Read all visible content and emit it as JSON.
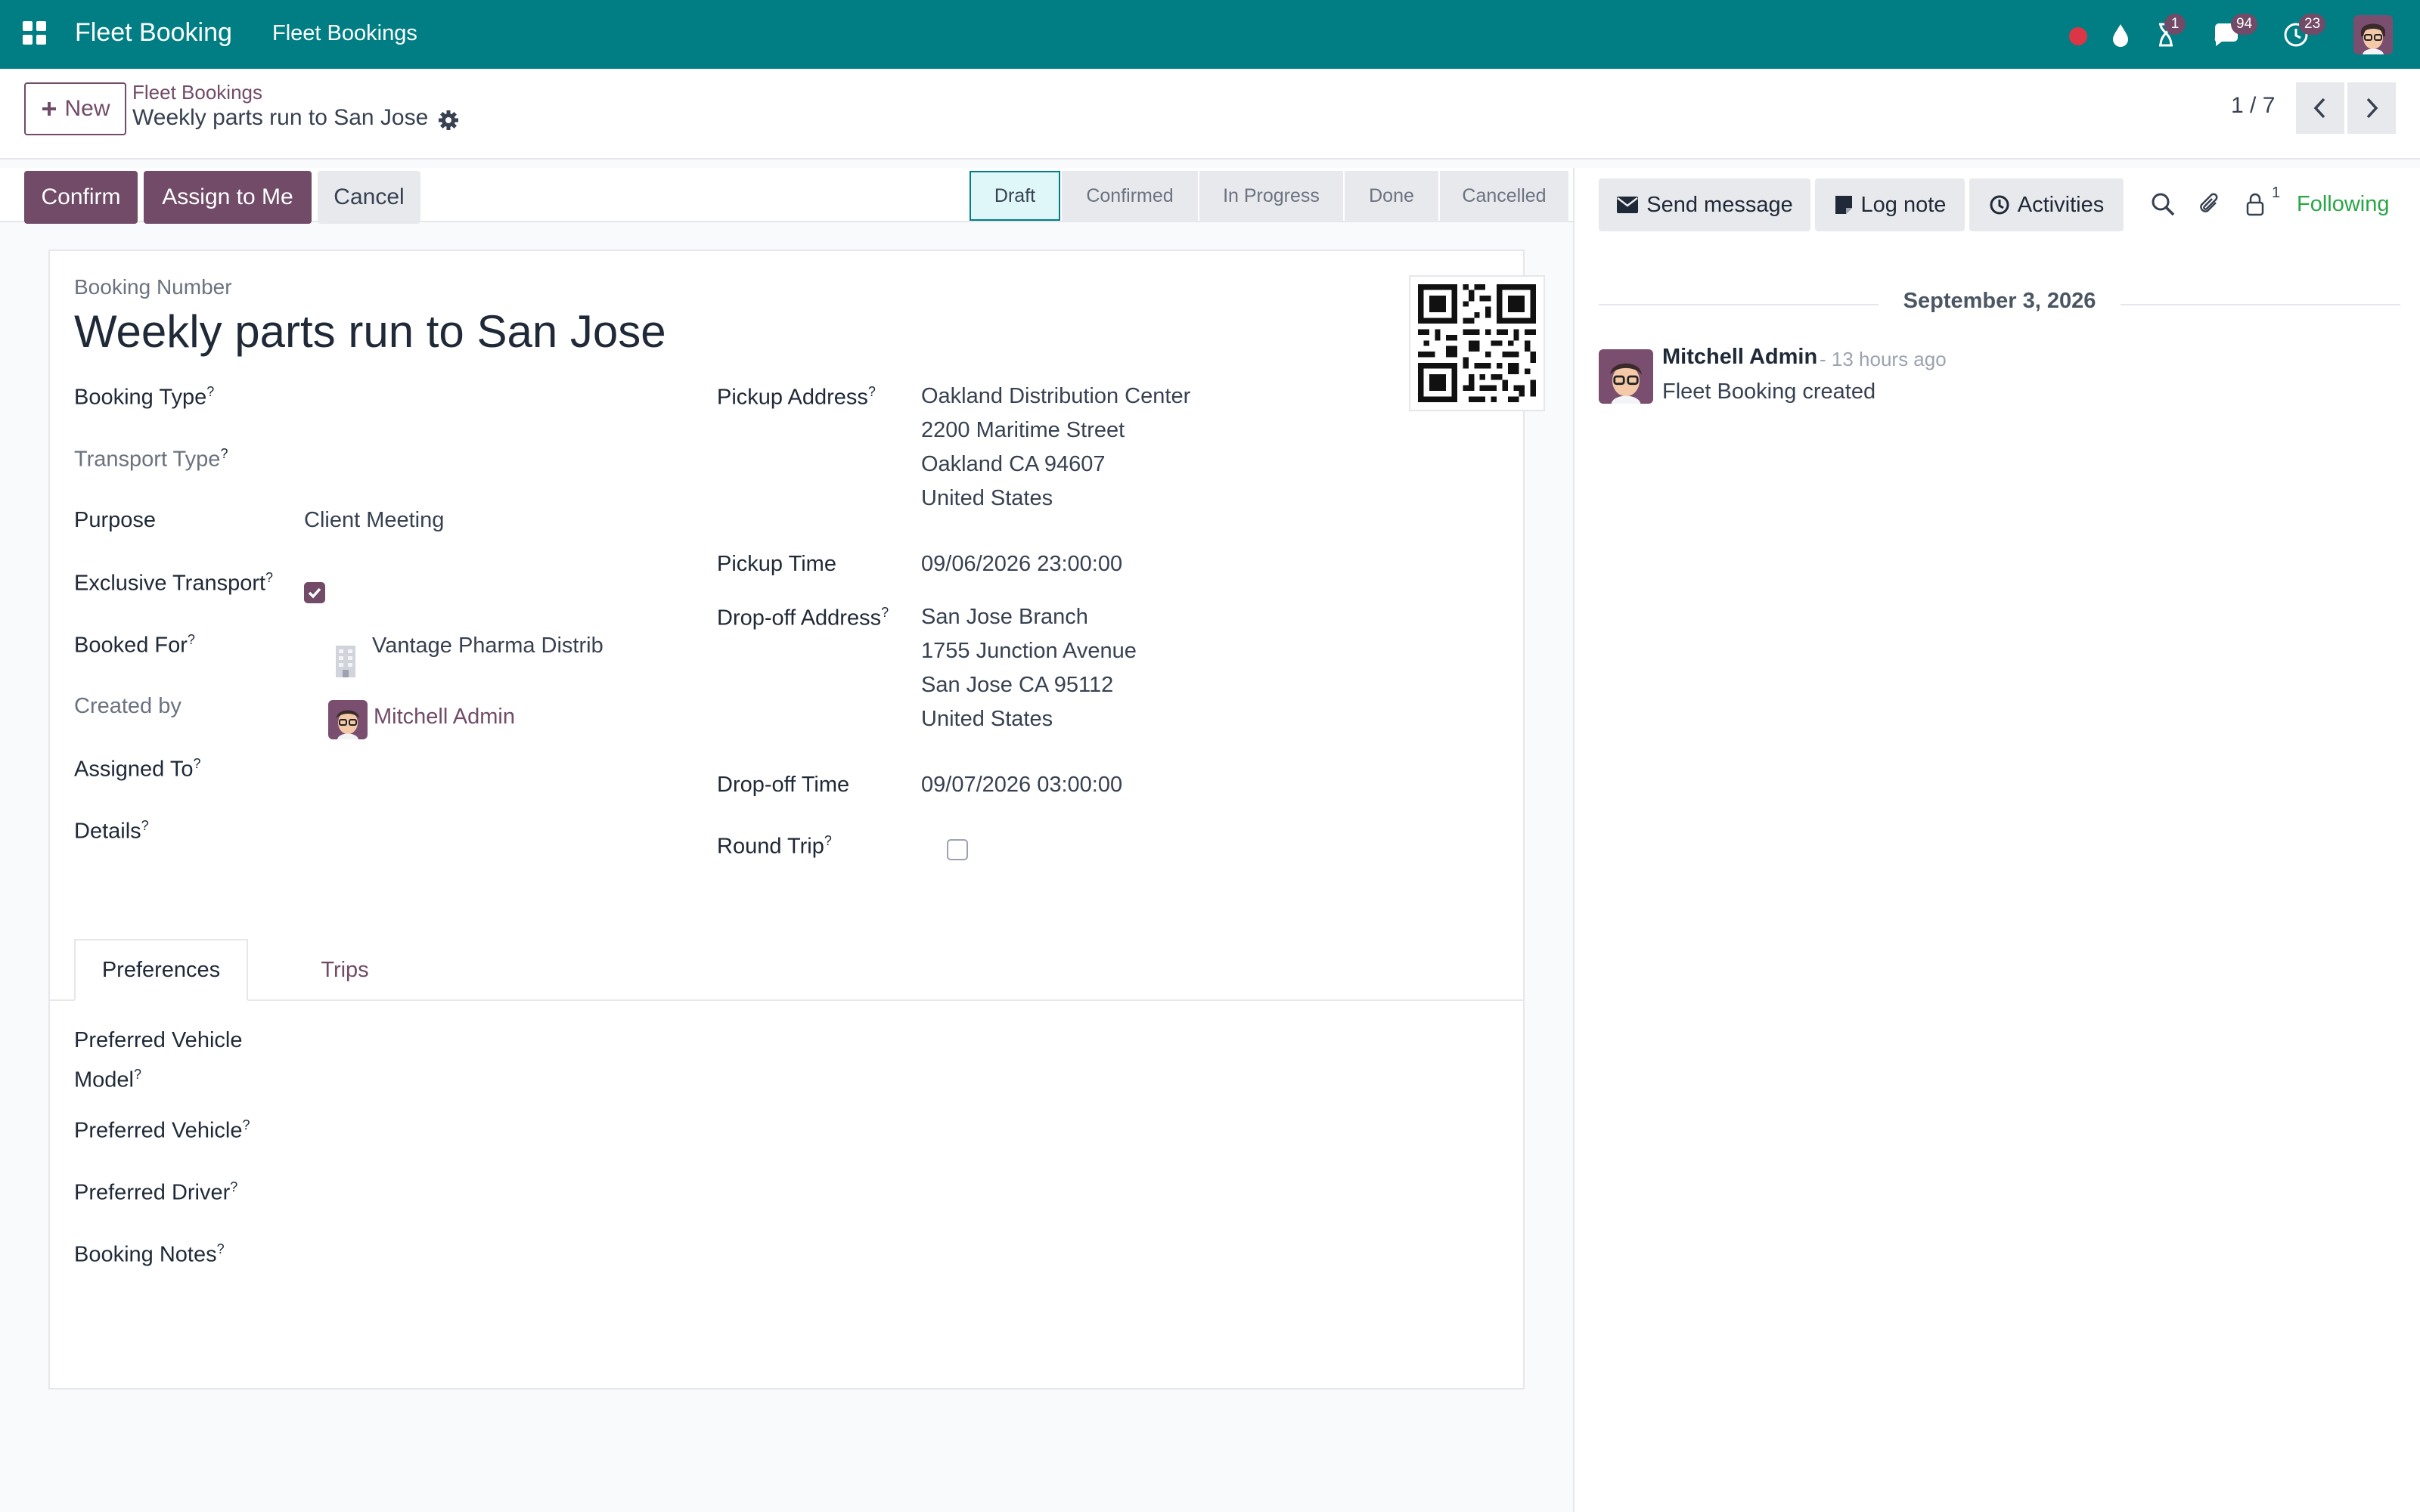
{
  "colors": {
    "navbar": "#017e84",
    "primary": "#714b67",
    "following": "#28a745",
    "notification_dot": "#dc3545"
  },
  "navbar": {
    "apps_icon": "apps-grid-icon",
    "app_name": "Fleet Booking",
    "menu_item": "Fleet Bookings",
    "icons": [
      "record-dot-icon",
      "drop-icon",
      "hourglass-icon",
      "chat-icon",
      "clock-icon"
    ],
    "badges": {
      "activities": "1",
      "messages": "94",
      "clock": "23"
    }
  },
  "control_panel": {
    "new_label": "New",
    "breadcrumb_parent": "Fleet Bookings",
    "breadcrumb_current": "Weekly parts run to San Jose",
    "pager": "1 / 7"
  },
  "actions": {
    "confirm": "Confirm",
    "assign_to_me": "Assign to Me",
    "cancel": "Cancel"
  },
  "stages": [
    "Draft",
    "Confirmed",
    "In Progress",
    "Done",
    "Cancelled"
  ],
  "active_stage": "Draft",
  "form": {
    "booking_number_label": "Booking Number",
    "title": "Weekly parts run to San Jose",
    "left": {
      "booking_type_label": "Booking Type",
      "transport_type_label": "Transport Type",
      "purpose_label": "Purpose",
      "purpose_value": "Client Meeting",
      "exclusive_transport_label": "Exclusive Transport",
      "exclusive_transport_checked": true,
      "booked_for_label": "Booked For",
      "booked_for_value": "Vantage Pharma Distrib",
      "created_by_label": "Created by",
      "created_by_value": "Mitchell Admin",
      "assigned_to_label": "Assigned To",
      "details_label": "Details"
    },
    "right": {
      "pickup_address_label": "Pickup Address",
      "pickup_address_lines": [
        "Oakland Distribution Center",
        "2200 Maritime Street",
        "Oakland CA 94607",
        "United States"
      ],
      "pickup_time_label": "Pickup Time",
      "pickup_time_value": "09/06/2026 23:00:00",
      "dropoff_address_label": "Drop-off Address",
      "dropoff_address_lines": [
        "San Jose Branch",
        "1755 Junction Avenue",
        "San Jose CA 95112",
        "United States"
      ],
      "dropoff_time_label": "Drop-off Time",
      "dropoff_time_value": "09/07/2026 03:00:00",
      "round_trip_label": "Round Trip",
      "round_trip_checked": false
    },
    "tabs": [
      "Preferences",
      "Trips"
    ],
    "preferences": {
      "preferred_vehicle_model_line1": "Preferred Vehicle",
      "preferred_vehicle_model_line2": "Model",
      "preferred_vehicle_label": "Preferred Vehicle",
      "preferred_driver_label": "Preferred Driver",
      "booking_notes_label": "Booking Notes"
    },
    "help_marker": "?"
  },
  "chatter": {
    "send_message": "Send message",
    "log_note": "Log note",
    "activities": "Activities",
    "followers_count": "1",
    "following": "Following",
    "date": "September 3, 2026",
    "message": {
      "author": "Mitchell Admin",
      "time": "- 13 hours ago",
      "body": "Fleet Booking created"
    }
  }
}
